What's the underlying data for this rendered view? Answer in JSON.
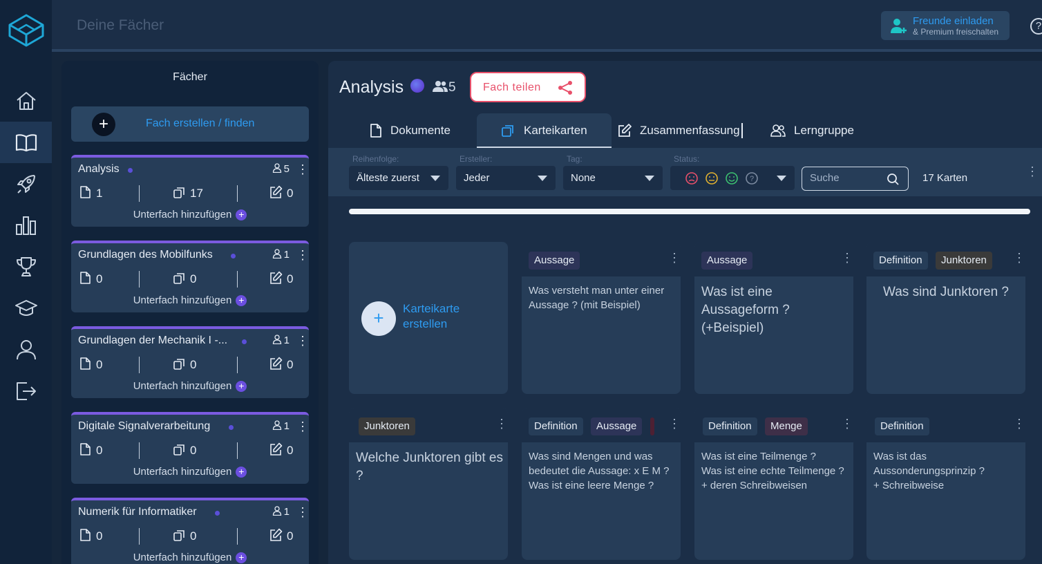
{
  "topbar": {
    "title": "Deine Fächer",
    "invite_line1": "Freunde einladen",
    "invite_line2": "& Premium freischalten",
    "help": "?"
  },
  "sidebar": {
    "title": "Fächer",
    "create_label": "Fach erstellen / finden",
    "add_sub_label": "Unterfach hinzufügen",
    "subjects": [
      {
        "name": "Analysis",
        "members": "5",
        "docs": "1",
        "cards": "17",
        "notes": "0"
      },
      {
        "name": "Grundlagen des Mobilfunks",
        "members": "1",
        "docs": "0",
        "cards": "0",
        "notes": "0"
      },
      {
        "name": "Grundlagen der Mechanik I -...",
        "members": "1",
        "docs": "0",
        "cards": "0",
        "notes": "0"
      },
      {
        "name": "Digitale Signalverarbeitung",
        "members": "1",
        "docs": "0",
        "cards": "0",
        "notes": "0"
      },
      {
        "name": "Numerik für Informatiker",
        "members": "1",
        "docs": "0",
        "cards": "0",
        "notes": "0"
      }
    ]
  },
  "main": {
    "subject_title": "Analysis",
    "members": "5",
    "share_label": "Fach teilen",
    "tabs": [
      {
        "label": "Dokumente",
        "icon": "document-icon"
      },
      {
        "label": "Karteikarten",
        "icon": "cards-icon"
      },
      {
        "label": "Zusammenfassung",
        "icon": "edit-icon"
      },
      {
        "label": "Lerngruppe",
        "icon": "group-icon"
      }
    ],
    "filters": {
      "order_label": "Reihenfolge:",
      "order_value": "Älteste zuerst",
      "creator_label": "Ersteller:",
      "creator_value": "Jeder",
      "tag_label": "Tag:",
      "tag_value": "None",
      "status_label": "Status:",
      "search_placeholder": "Suche",
      "count": "17 Karten"
    },
    "create_card_label": "Karteikarte\nerstellen",
    "cards": [
      {
        "tags": [
          "Aussage"
        ],
        "text": "Was versteht man unter einer Aussage ? (mit Beispiel)"
      },
      {
        "tags": [
          "Aussage"
        ],
        "text": "Was ist eine Aussageform ? (+Beispiel)"
      },
      {
        "tags": [
          "Definition",
          "Junktoren"
        ],
        "text": "Was sind Junktoren ?"
      },
      {
        "tags": [
          "Junktoren"
        ],
        "text": "Welche Junktoren gibt es ?"
      },
      {
        "tags": [
          "Definition",
          "Aussage"
        ],
        "text": "Was sind Mengen und was bedeutet die Aussage: x E M ?\nWas ist eine leere Menge ?"
      },
      {
        "tags": [
          "Definition",
          "Menge"
        ],
        "text": "Was ist eine Teilmenge ?\nWas ist eine echte Teilmenge ?\n+ deren Schreibweisen"
      },
      {
        "tags": [
          "Definition"
        ],
        "text": "Was ist das Aussonderungsprinzip ?\n+ Schreibweise"
      }
    ]
  },
  "colors": {
    "accent": "#2e9bf0",
    "share": "#e8506a",
    "purple": "#6b4fe0",
    "background": "#15263b"
  }
}
